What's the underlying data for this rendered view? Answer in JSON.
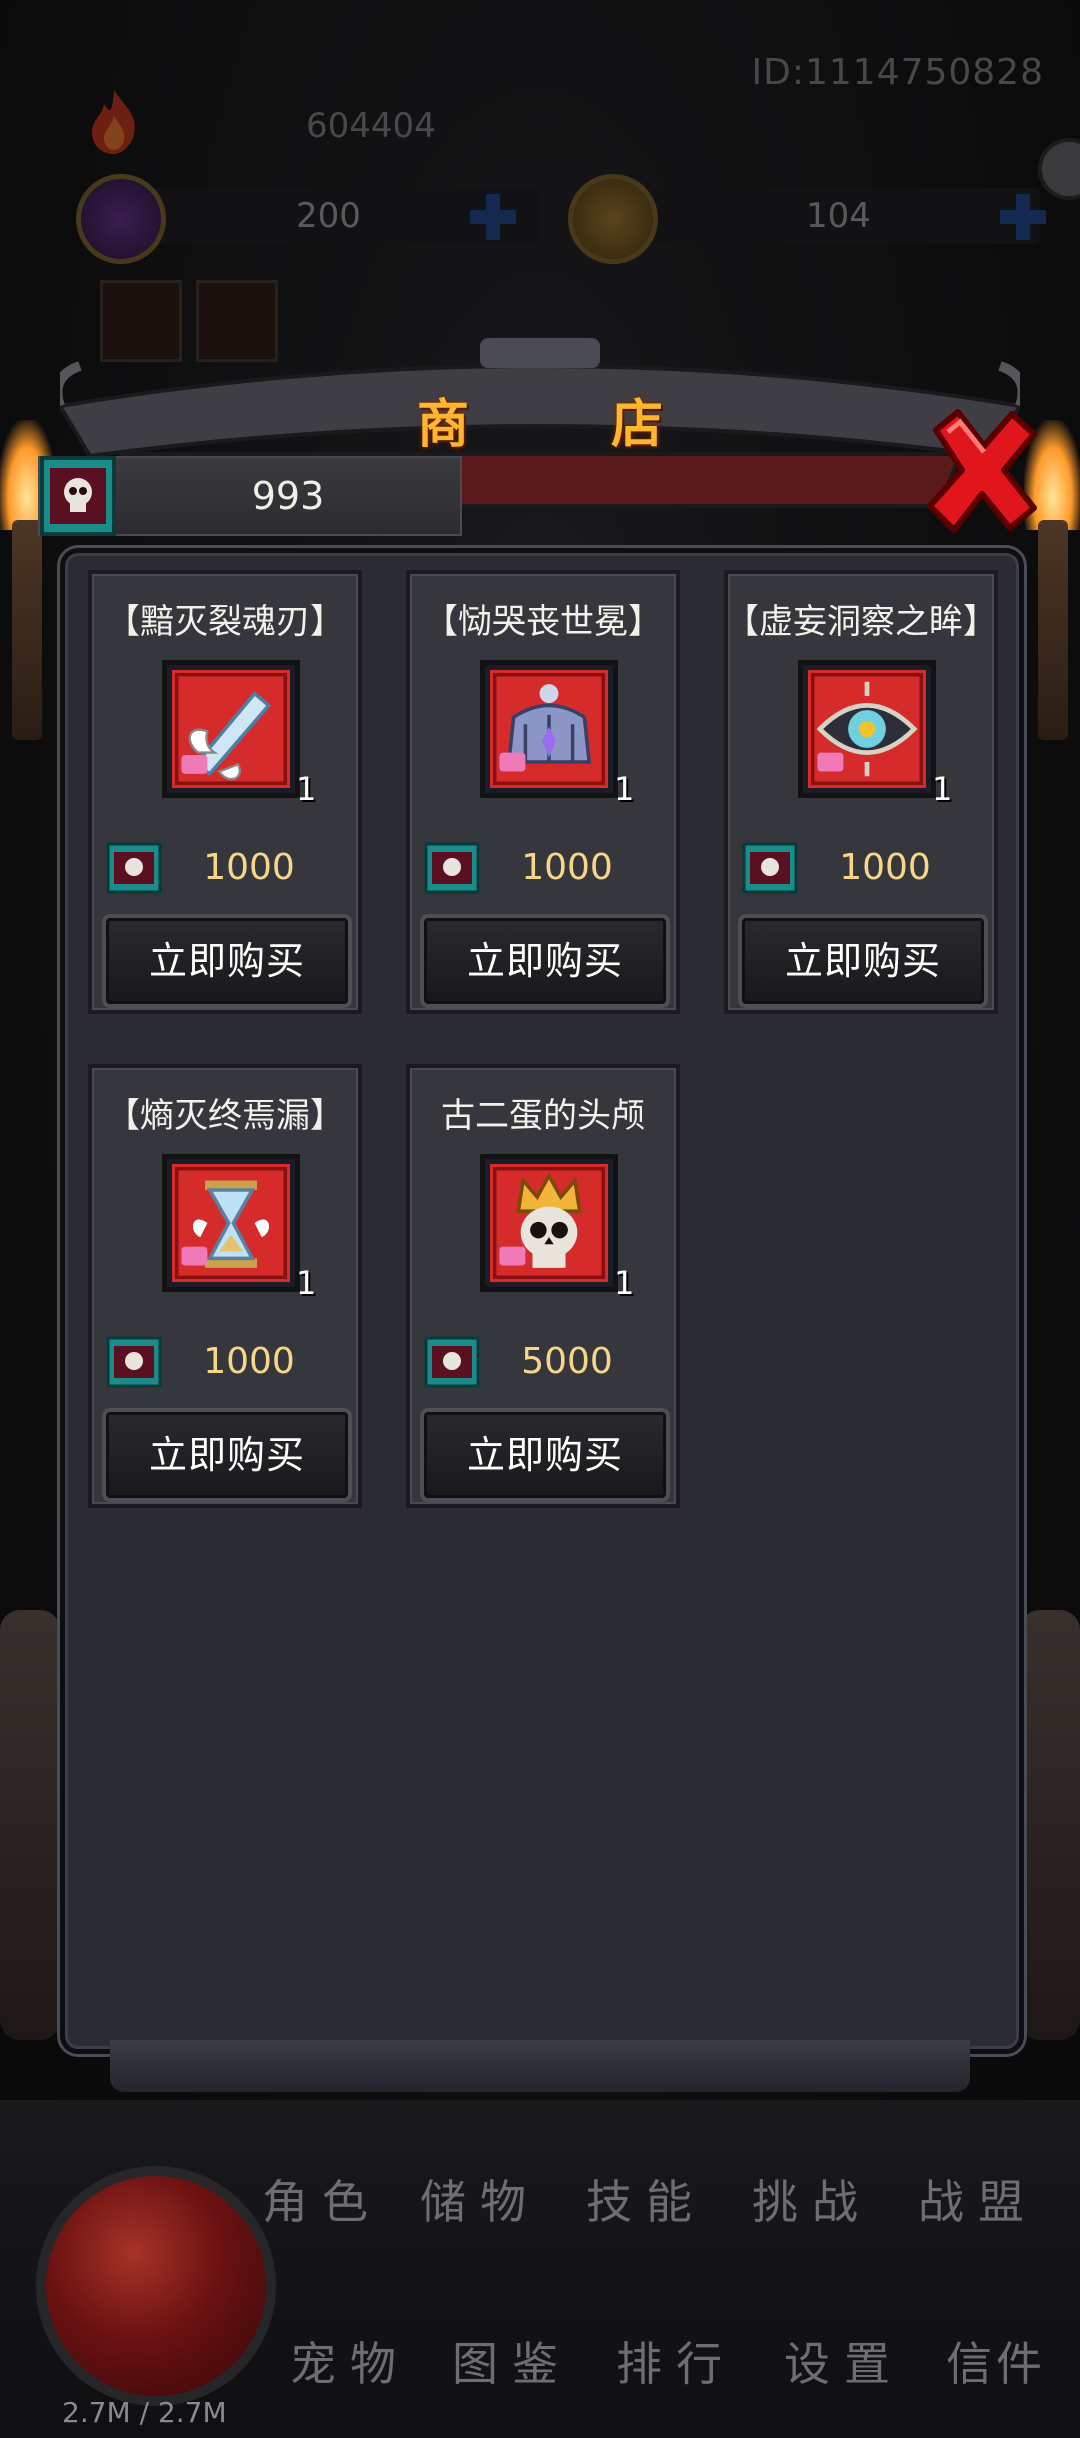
{
  "hud": {
    "player_id": "ID:1114750828",
    "power": "604404",
    "gems": "200",
    "coins": "104",
    "buff_1_icon": "ming-badge-icon",
    "buff_2_icon": "demon-badge-icon"
  },
  "shop": {
    "title": "商 店",
    "currency_amount": "993",
    "currency_icon": "skull-ticket-icon",
    "items": [
      {
        "name": "【黯灭裂魂刃】",
        "icon": "winged-sword-icon",
        "count": "1",
        "price": "1000",
        "buy_label": "立即购买"
      },
      {
        "name": "【恸哭丧世冕】",
        "icon": "crown-icon",
        "count": "1",
        "price": "1000",
        "buy_label": "立即购买"
      },
      {
        "name": "【虚妄洞察之眸】",
        "icon": "eye-icon",
        "count": "1",
        "price": "1000",
        "buy_label": "立即购买"
      },
      {
        "name": "【熵灭终焉漏】",
        "icon": "hourglass-icon",
        "count": "1",
        "price": "1000",
        "buy_label": "立即购买"
      },
      {
        "name": "古二蛋的头颅",
        "icon": "crowned-skull-icon",
        "count": "1",
        "price": "5000",
        "buy_label": "立即购买"
      }
    ]
  },
  "nav": {
    "row1": [
      "角色",
      "储物",
      "技能",
      "挑战",
      "战盟"
    ],
    "row2": [
      "宠物",
      "图鉴",
      "排行",
      "设置",
      "信件"
    ],
    "hp": "2.7M / 2.7M"
  },
  "colors": {
    "title": "#ffb52e",
    "price": "#f7d68a",
    "panel": "#2b2c33",
    "card": "#36373d",
    "close": "#e0161c"
  }
}
